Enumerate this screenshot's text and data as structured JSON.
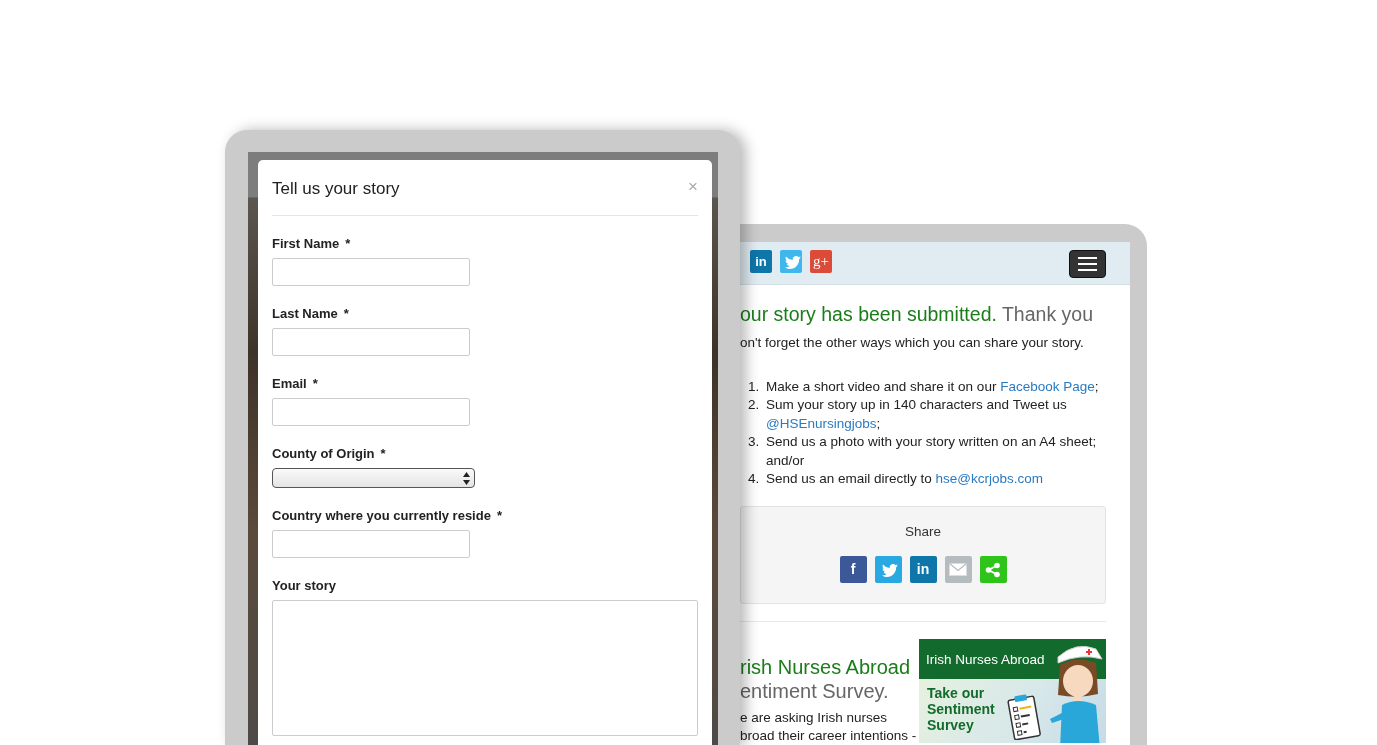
{
  "left_screen": {
    "modal": {
      "title": "Tell us your story",
      "close": "×",
      "fields": [
        {
          "label": "First Name",
          "required_mark": "*",
          "kind": "text"
        },
        {
          "label": "Last Name",
          "required_mark": "*",
          "kind": "text"
        },
        {
          "label": "Email",
          "required_mark": "*",
          "kind": "text"
        },
        {
          "label": "County of Origin",
          "required_mark": "*",
          "kind": "select"
        },
        {
          "label": "Country where you currently reside",
          "required_mark": "*",
          "kind": "text"
        },
        {
          "label": "Your story",
          "kind": "textarea"
        }
      ]
    }
  },
  "right_screen": {
    "social_icons": [
      {
        "kind": "linkedin",
        "glyph": "in"
      },
      {
        "kind": "twitter"
      },
      {
        "kind": "googleplus",
        "glyph": "g+"
      }
    ],
    "heading": {
      "lead": "our story has been submitted.",
      "rest": "Thank you"
    },
    "intro": "on't forget the other ways which you can share your story.",
    "steps": [
      {
        "number": "1.",
        "text": "Make a short video and share it on our ",
        "link": "Facebook Page",
        "after": ";"
      },
      {
        "number": "2.",
        "text": "Sum your story up in 140 characters and Tweet us ",
        "link": "@HSEnursingjobs",
        "after": ";"
      },
      {
        "number": "3.",
        "text": "Send us a photo with your story written on an A4 sheet; and/or"
      },
      {
        "number": "4.",
        "text": "Send us an email directly to ",
        "link": "hse@kcrjobs.com"
      }
    ],
    "share": {
      "title": "Share",
      "buttons": [
        {
          "kind": "facebook",
          "glyph": "f"
        },
        {
          "kind": "twitter"
        },
        {
          "kind": "linkedin",
          "glyph": "in"
        },
        {
          "kind": "email"
        },
        {
          "kind": "share"
        }
      ]
    },
    "survey": {
      "heading": {
        "lead": "rish Nurses Abroad",
        "rest": "entiment Survey."
      },
      "body_lines": [
        "e are asking Irish nurses",
        "broad their career intentions -"
      ],
      "banner": {
        "band_text": "Irish Nurses Abroad",
        "cta": "Take our Sentiment Survey"
      }
    }
  }
}
